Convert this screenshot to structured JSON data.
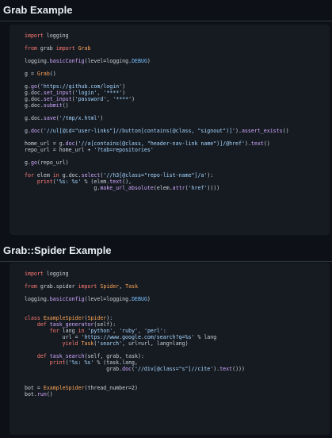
{
  "sections": [
    {
      "title": "Grab Example",
      "code_lines": [
        "import logging",
        "",
        "from grab import Grab",
        "",
        "logging.basicConfig(level=logging.DEBUG)",
        "",
        "g = Grab()",
        "",
        "g.go('https://github.com/login')",
        "g.doc.set_input('login', '****')",
        "g.doc.set_input('password', '****')",
        "g.doc.submit()",
        "",
        "g.doc.save('/tmp/x.html')",
        "",
        "g.doc('//ul[@id=\"user-links\"]//button[contains(@class, \"signout\")]').assert_exists()",
        "",
        "home_url = g.doc('//a[contains(@class, \"header-nav-link name\")]/@href').text()",
        "repo_url = home_url + '?tab=repositories'",
        "",
        "g.go(repo_url)",
        "",
        "for elem in g.doc.select('//h3[@class=\"repo-list-name\"]/a'):",
        "    print('%s: %s' % (elem.text(),",
        "                      g.make_url_absolute(elem.attr('href'))))"
      ]
    },
    {
      "title": "Grab::Spider Example",
      "code_lines": [
        "import logging",
        "",
        "from grab.spider import Spider, Task",
        "",
        "logging.basicConfig(level=logging.DEBUG)",
        "",
        "",
        "class ExampleSpider(Spider):",
        "    def task_generator(self):",
        "        for lang in 'python', 'ruby', 'perl':",
        "            url = 'https://www.google.com/search?q=%s' % lang",
        "            yield Task('search', url=url, lang=lang)",
        "",
        "    def task_search(self, grab, task):",
        "        print('%s: %s' % (task.lang,",
        "                          grab.doc('//div[@class=\"s\"]//cite').text()))",
        "",
        "",
        "bot = ExampleSpider(thread_number=2)",
        "bot.run()"
      ]
    }
  ],
  "colors": {
    "background": "#0d1117",
    "code_background": "#161b22",
    "keyword": "#ff7b72",
    "function": "#d2a8ff",
    "string": "#a5d6ff",
    "constant": "#79c0ff"
  }
}
